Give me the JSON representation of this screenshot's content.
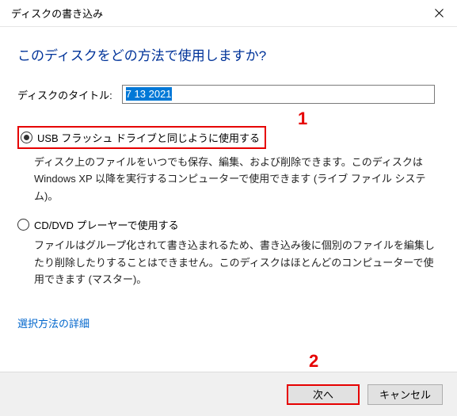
{
  "window": {
    "title": "ディスクの書き込み"
  },
  "heading": "このディスクをどの方法で使用しますか?",
  "disc_title": {
    "label": "ディスクのタイトル:",
    "value": "7 13 2021"
  },
  "options": [
    {
      "label": "USB フラッシュ ドライブと同じように使用する",
      "desc": "ディスク上のファイルをいつでも保存、編集、および削除できます。このディスクは Windows XP 以降を実行するコンピューターで使用できます (ライブ ファイル システム)。",
      "checked": true
    },
    {
      "label": "CD/DVD プレーヤーで使用する",
      "desc": "ファイルはグループ化されて書き込まれるため、書き込み後に個別のファイルを編集したり削除したりすることはできません。このディスクはほとんどのコンピューターで使用できます (マスター)。",
      "checked": false
    }
  ],
  "link": "選択方法の詳細",
  "buttons": {
    "next": "次へ",
    "cancel": "キャンセル"
  },
  "annotations": {
    "a1": "1",
    "a2": "2"
  }
}
